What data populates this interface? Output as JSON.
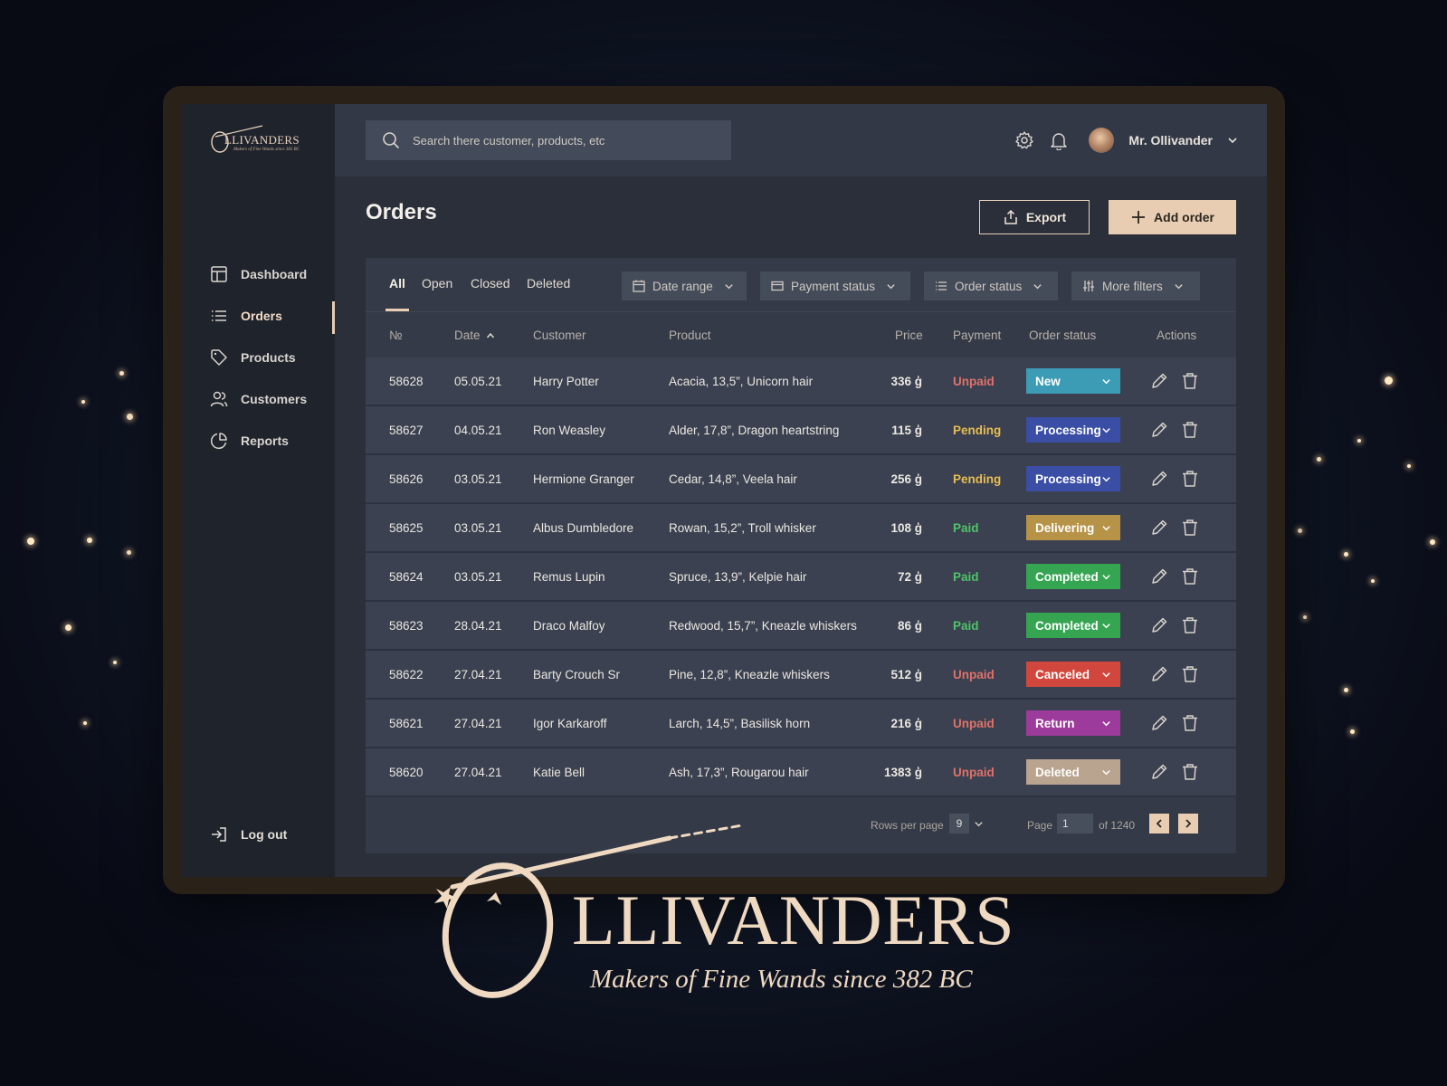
{
  "brand": {
    "name": "LLIVANDERS",
    "tagline": "Makers of Fine Wands since 382 BC",
    "accent": "#e8cdb2"
  },
  "sidebar": {
    "items": [
      {
        "label": "Dashboard",
        "icon": "layout-icon"
      },
      {
        "label": "Orders",
        "icon": "list-icon",
        "active": true
      },
      {
        "label": "Products",
        "icon": "tag-icon"
      },
      {
        "label": "Customers",
        "icon": "users-icon"
      },
      {
        "label": "Reports",
        "icon": "pie-chart-icon"
      }
    ],
    "logout_label": "Log out"
  },
  "topbar": {
    "search_placeholder": "Search there customer, products, etc",
    "user_name": "Mr. Ollivander"
  },
  "page": {
    "title": "Orders",
    "export_label": "Export",
    "add_label": "Add order"
  },
  "tabs": [
    "All",
    "Open",
    "Closed",
    "Deleted"
  ],
  "filters": {
    "date_range": "Date range",
    "payment_status": "Payment status",
    "order_status": "Order status",
    "more_filters": "More filters"
  },
  "table": {
    "columns": {
      "number": "№",
      "date": "Date",
      "customer": "Customer",
      "product": "Product",
      "price": "Price",
      "payment": "Payment",
      "order_status": "Order status",
      "actions": "Actions"
    },
    "rows": [
      {
        "id": "58628",
        "date": "05.05.21",
        "customer": "Harry Potter",
        "product": "Acacia, 13,5”, Unicorn hair",
        "price": "336 ģ",
        "payment": "Unpaid",
        "status": "New"
      },
      {
        "id": "58627",
        "date": "04.05.21",
        "customer": "Ron Weasley",
        "product": "Alder, 17,8”, Dragon heartstring",
        "price": "115 ģ",
        "payment": "Pending",
        "status": "Processing"
      },
      {
        "id": "58626",
        "date": "03.05.21",
        "customer": "Hermione Granger",
        "product": "Cedar, 14,8”, Veela hair",
        "price": "256 ģ",
        "payment": "Pending",
        "status": "Processing"
      },
      {
        "id": "58625",
        "date": "03.05.21",
        "customer": "Albus Dumbledore",
        "product": "Rowan, 15,2”, Troll whisker",
        "price": "108 ģ",
        "payment": "Paid",
        "status": "Delivering"
      },
      {
        "id": "58624",
        "date": "03.05.21",
        "customer": "Remus Lupin",
        "product": "Spruce, 13,9”, Kelpie hair",
        "price": "72 ģ",
        "payment": "Paid",
        "status": "Completed"
      },
      {
        "id": "58623",
        "date": "28.04.21",
        "customer": "Draco Malfoy",
        "product": "Redwood, 15,7”, Kneazle whiskers",
        "price": "86 ģ",
        "payment": "Paid",
        "status": "Completed"
      },
      {
        "id": "58622",
        "date": "27.04.21",
        "customer": "Barty Crouch Sr",
        "product": "Pine, 12,8”, Kneazle whiskers",
        "price": "512 ģ",
        "payment": "Unpaid",
        "status": "Canceled"
      },
      {
        "id": "58621",
        "date": "27.04.21",
        "customer": "Igor Karkaroff",
        "product": "Larch, 14,5”, Basilisk horn",
        "price": "216 ģ",
        "payment": "Unpaid",
        "status": "Return"
      },
      {
        "id": "58620",
        "date": "27.04.21",
        "customer": "Katie Bell",
        "product": "Ash, 17,3”, Rougarou hair",
        "price": "1383 ģ",
        "payment": "Unpaid",
        "status": "Deleted"
      }
    ]
  },
  "payment_colors": {
    "Unpaid": "#e0726b",
    "Pending": "#e7bd52",
    "Paid": "#4fc46a"
  },
  "status_colors": {
    "New": "#3c9cb5",
    "Processing": "#3b4ea6",
    "Delivering": "#b69347",
    "Completed": "#35a552",
    "Canceled": "#d2473d",
    "Return": "#9c3b9b",
    "Deleted": "#b9a48f"
  },
  "pagination": {
    "rows_per_page_label": "Rows per page",
    "rows_per_page": "9",
    "page_label": "Page",
    "page": "1",
    "of_label": "of 1240"
  }
}
